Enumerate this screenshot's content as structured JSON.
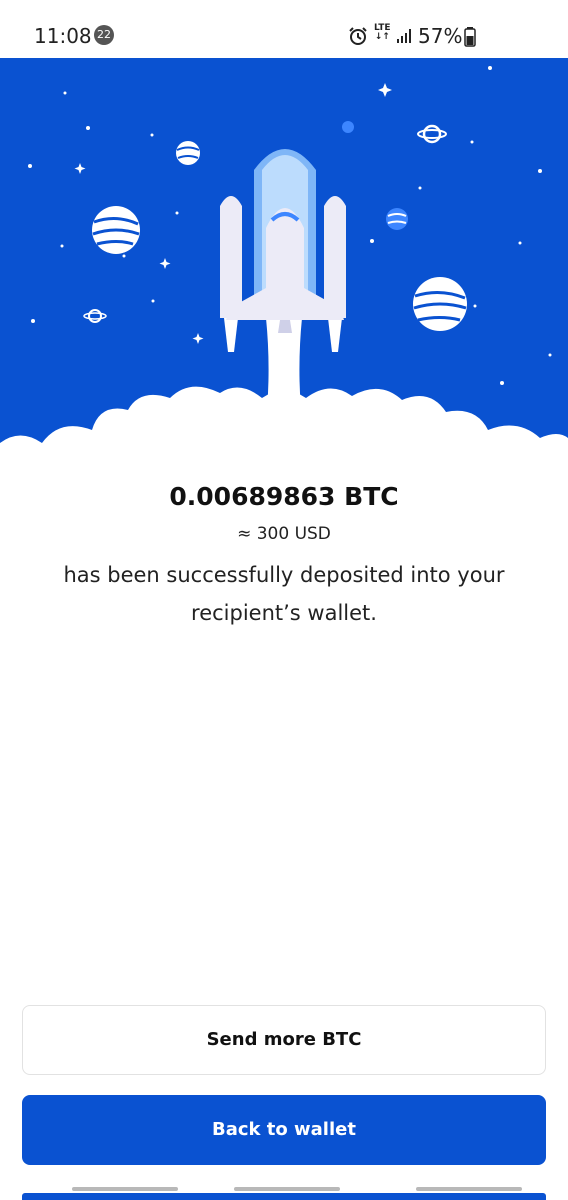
{
  "status_bar": {
    "time": "11:08",
    "notification_count": "22",
    "network": "LTE",
    "battery": "57%"
  },
  "hero": {
    "illustration": "rocket-launch",
    "background_color": "#0a52d1"
  },
  "result": {
    "amount": "0.00689863 BTC",
    "usd_equivalent": "≈ 300 USD",
    "message": "has been successfully deposited into your recipient’s wallet."
  },
  "actions": {
    "send_more_label": "Send more BTC",
    "back_label": "Back to wallet"
  },
  "colors": {
    "accent": "#0a52d1",
    "text": "#111111"
  }
}
